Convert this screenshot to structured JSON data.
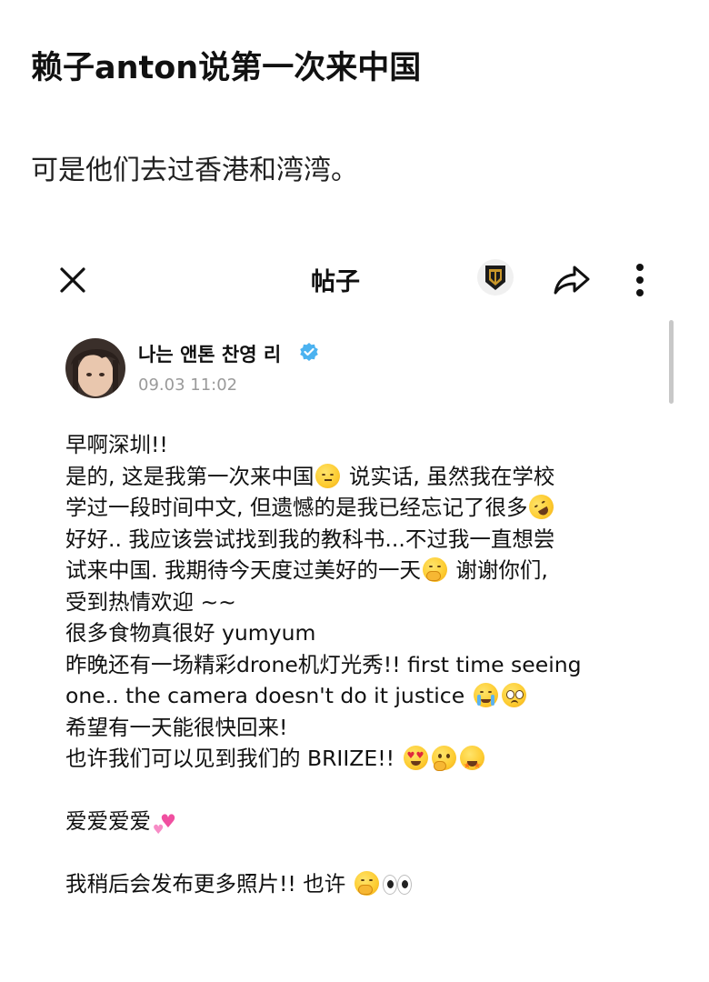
{
  "article": {
    "title": "赖子anton说第一次来中国",
    "subtitle": "可是他们去过香港和湾湾。"
  },
  "topbar": {
    "title": "帖子",
    "icons": [
      "close-icon",
      "app-badge-icon",
      "share-icon",
      "more-vertical-icon"
    ]
  },
  "post": {
    "author": "나는 앤톤 찬영 리",
    "verified_color": "#4bb2f0",
    "time": "09.03 11:02",
    "lines": {
      "l1": "早啊深圳!!",
      "l2a": "是的, 这是我第一次来中国",
      "l2b": " 说实话, 虽然我在学校",
      "l3": "学过一段时间中文, 但遗憾的是我已经忘记了很多",
      "l4": "好好.. 我应该尝试找到我的教科书...不过我一直想尝",
      "l5a": "试来中国. 我期待今天度过美好的一天",
      "l5b": "  谢谢你们,",
      "l6": "受到热情欢迎 ~~",
      "l7": "很多食物真很好 yumyum",
      "l8": "昨晚还有一场精彩drone机灯光秀!! first time seeing",
      "l9": "one.. the camera doesn't do it justice ",
      "l10": "希望有一天能很快回来!",
      "l11": "也许我们可以见到我们的 BRIIZE!! ",
      "l12": "爱爱爱爱",
      "l13": "我稍后会发布更多照片!! 也许 "
    },
    "emoji_names": [
      "pensive-face",
      "rofl-face",
      "hand-over-mouth-face",
      "crying-face",
      "pleading-face",
      "heart-eyes-face",
      "thinking-face",
      "star-struck-face",
      "two-hearts",
      "hand-over-mouth-face",
      "eyes"
    ]
  }
}
